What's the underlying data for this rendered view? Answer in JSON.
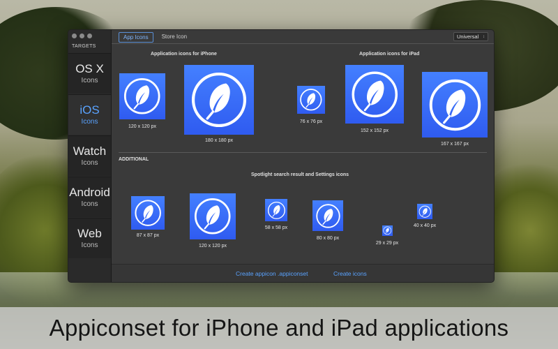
{
  "sidebar": {
    "title": "TARGETS",
    "items": [
      {
        "name": "OS X",
        "sub": "Icons"
      },
      {
        "name": "iOS",
        "sub": "Icons"
      },
      {
        "name": "Watch",
        "sub": "Icons"
      },
      {
        "name": "Android",
        "sub": "Icons"
      },
      {
        "name": "Web",
        "sub": "Icons"
      }
    ],
    "active_index": 1
  },
  "tabs": [
    {
      "label": "App Icons",
      "active": true
    },
    {
      "label": "Store Icon",
      "active": false
    }
  ],
  "device_select": {
    "value": "Universal"
  },
  "sections": {
    "iphone_title": "Application icons for iPhone",
    "ipad_title": "Application icons for iPad",
    "additional_label": "ADDITIONAL",
    "spotlight_title": "Spotlight search result and Settings icons"
  },
  "icons": {
    "iphone": [
      {
        "label": "120 x 120 px"
      },
      {
        "label": "180 x 180 px"
      }
    ],
    "ipad": [
      {
        "label": "76 x 76 px"
      },
      {
        "label": "152 x 152 px"
      },
      {
        "label": "167 x 167 px"
      }
    ],
    "spotlight": [
      {
        "label": "87 x 87 px"
      },
      {
        "label": "120 x 120 px"
      },
      {
        "label": "58 x 58 px"
      },
      {
        "label": "80 x 80 px"
      },
      {
        "label": "29 x 29 px"
      },
      {
        "label": "40 x 40 px"
      }
    ],
    "icon_name": "feather-icon"
  },
  "bottom": {
    "create_appiconset": "Create appicon .appiconset",
    "create_icons": "Create icons"
  },
  "banner": {
    "text": "Appiconset for iPhone and iPad applications"
  },
  "colors": {
    "accent": "#5aa3ff",
    "icon_blue": "#3366f5"
  }
}
